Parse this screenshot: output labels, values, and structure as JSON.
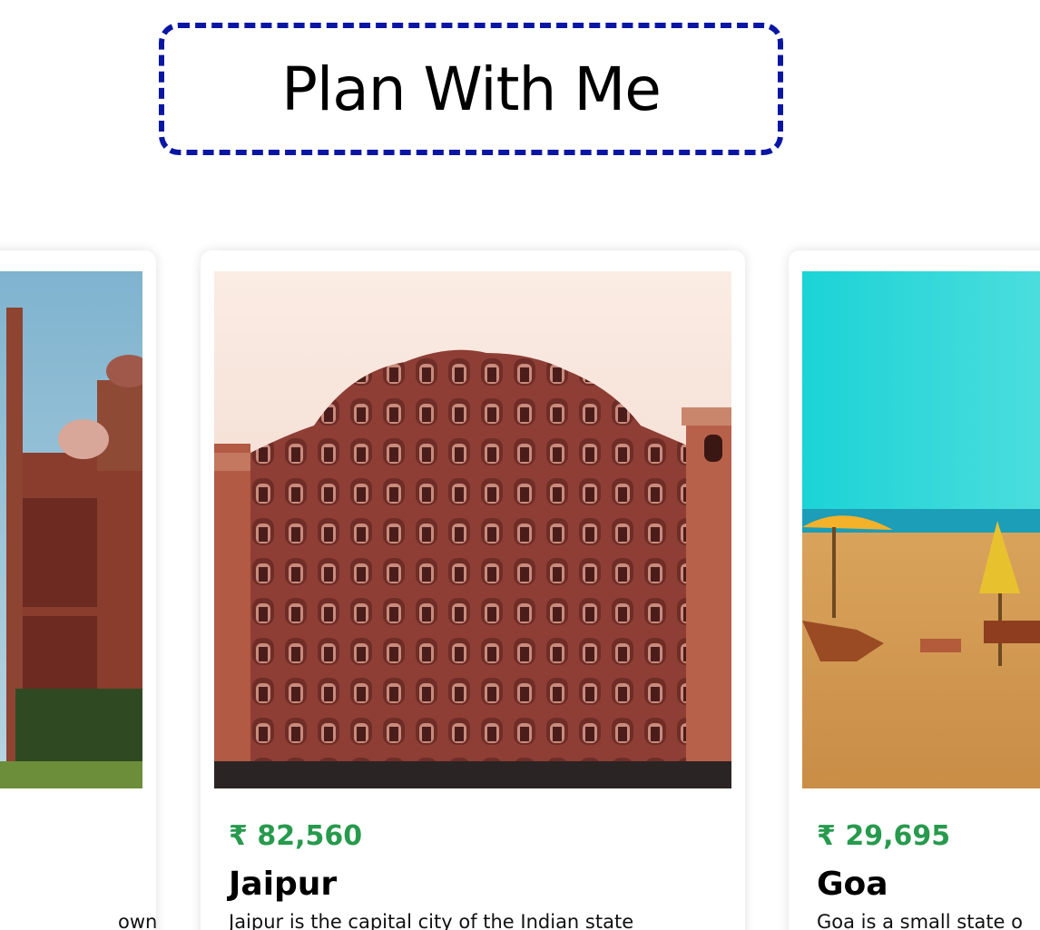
{
  "header": {
    "title": "Plan With Me"
  },
  "cards": [
    {
      "image": "taj-mahal-photo",
      "price": "",
      "name": "",
      "description": "own for the"
    },
    {
      "image": "hawa-mahal-photo",
      "price": "₹ 82,560",
      "name": "Jaipur",
      "description": "Jaipur is the capital city of the Indian state"
    },
    {
      "image": "goa-beach-photo",
      "price": "₹ 29,695",
      "name": "Goa",
      "description": "Goa is a small state o"
    }
  ],
  "colors": {
    "title_border": "#0a16a3",
    "price": "#279a4d"
  }
}
